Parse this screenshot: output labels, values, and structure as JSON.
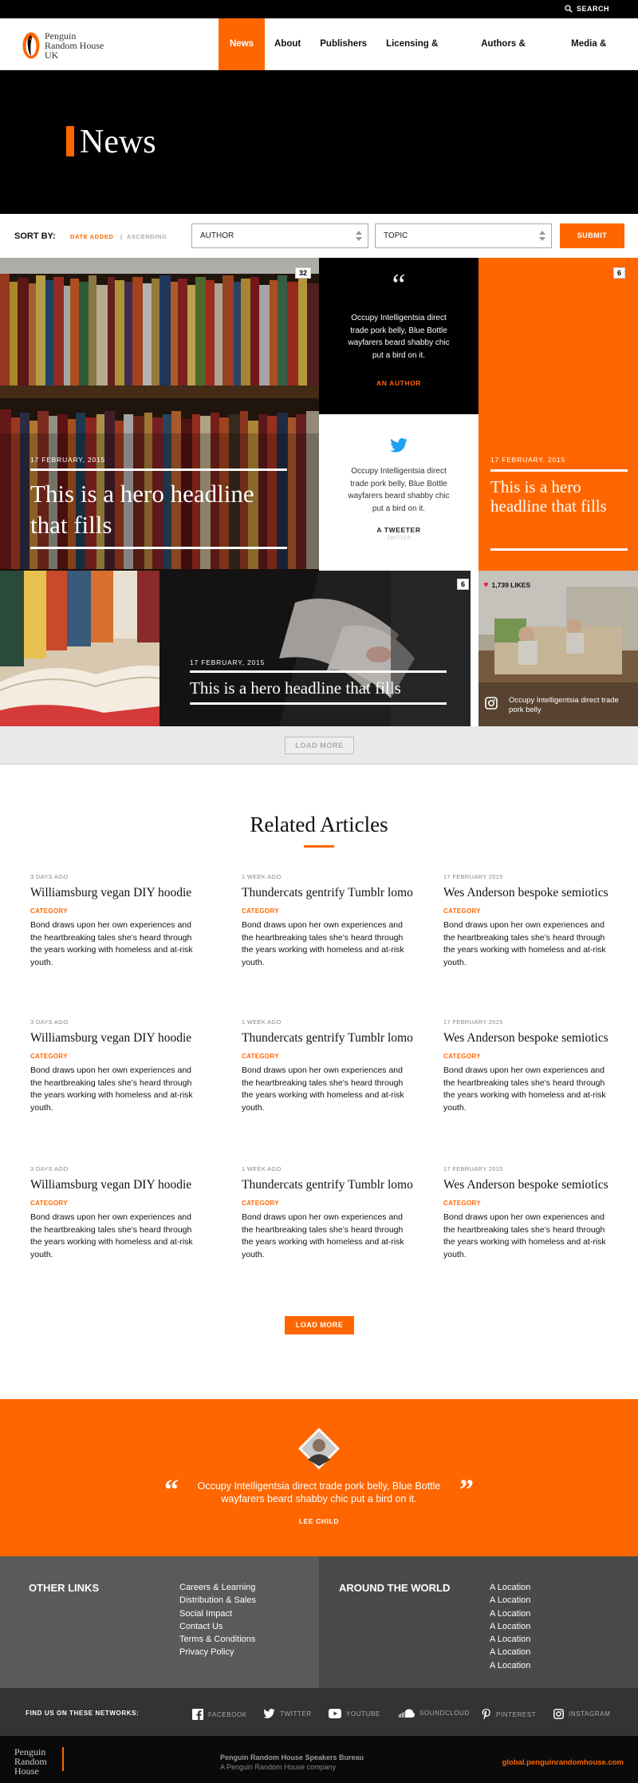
{
  "topbar": {
    "search_label": "SEARCH"
  },
  "logo": {
    "line1": "Penguin",
    "line2": "Random House",
    "line3": "UK"
  },
  "nav": {
    "items": [
      "News",
      "About",
      "Publishers",
      "Licensing & Rights",
      "Authors & Agents",
      "Media & Press"
    ]
  },
  "hero": {
    "title": "News"
  },
  "sort": {
    "label": "SORT BY:",
    "option1": "DATE ADDED",
    "separator": "|",
    "option2": "ASCENDING",
    "author_select": "AUTHOR",
    "topic_select": "TOPIC",
    "submit": "SUBMIT"
  },
  "grid": {
    "big": {
      "badge": "32",
      "date": "17 FEBRUARY, 2015",
      "headline": "This is a hero headline that fills"
    },
    "quote": {
      "mark": "“",
      "text": "Occupy Intelligentsia direct trade pork belly, Blue Bottle wayfarers beard shabby chic put a bird on it.",
      "author": "AN AUTHOR"
    },
    "tweet": {
      "text": "Occupy Intelligentsia direct trade pork belly, Blue Bottle wayfarers beard shabby chic put a bird on it.",
      "author": "A TWEETER",
      "sub": "TWITTER"
    },
    "orange": {
      "badge": "6",
      "date": "17 FEBRUARY, 2015",
      "headline": "This is a hero headline that fills"
    },
    "wide": {
      "badge": "6",
      "date": "17 FEBRUARY, 2015",
      "headline": "This is a hero headline that fills"
    },
    "insta": {
      "likes": "1,739 LIKES",
      "caption": "Occupy Intelligentsia direct trade pork belly"
    }
  },
  "load_more_top": "LOAD MORE",
  "related": {
    "title": "Related Articles",
    "articles": [
      {
        "age": "3 DAYS AGO",
        "title": "Williamsburg vegan DIY hoodie",
        "category": "CATEGORY",
        "body": "Bond draws upon her own experiences and the heartbreaking tales she’s heard through the years working with homeless and at-risk youth."
      },
      {
        "age": "1 WEEK AGO",
        "title": "Thundercats gentrify Tumblr lomo",
        "category": "CATEGORY",
        "body": "Bond draws upon her own experiences and the heartbreaking tales she’s heard through the years working with homeless and at-risk youth."
      },
      {
        "age": "17 FEBRUARY 2015",
        "title": "Wes Anderson bespoke semiotics",
        "category": "CATEGORY",
        "body": "Bond draws upon her own experiences and the heartbreaking tales she’s heard through the years working with homeless and at-risk youth."
      },
      {
        "age": "3 DAYS AGO",
        "title": "Williamsburg vegan DIY hoodie",
        "category": "CATEGORY",
        "body": "Bond draws upon her own experiences and the heartbreaking tales she’s heard through the years working with homeless and at-risk youth."
      },
      {
        "age": "1 WEEK AGO",
        "title": "Thundercats gentrify Tumblr lomo",
        "category": "CATEGORY",
        "body": "Bond draws upon her own experiences and the heartbreaking tales she’s heard through the years working with homeless and at-risk youth."
      },
      {
        "age": "17 FEBRUARY 2015",
        "title": "Wes Anderson bespoke semiotics",
        "category": "CATEGORY",
        "body": "Bond draws upon her own experiences and the heartbreaking tales she’s heard through the years working with homeless and at-risk youth."
      },
      {
        "age": "3 DAYS AGO",
        "title": "Williamsburg vegan DIY hoodie",
        "category": "CATEGORY",
        "body": "Bond draws upon her own experiences and the heartbreaking tales she’s heard through the years working with homeless and at-risk youth."
      },
      {
        "age": "1 WEEK AGO",
        "title": "Thundercats gentrify Tumblr lomo",
        "category": "CATEGORY",
        "body": "Bond draws upon her own experiences and the heartbreaking tales she’s heard through the years working with homeless and at-risk youth."
      },
      {
        "age": "17 FEBRUARY 2015",
        "title": "Wes Anderson bespoke semiotics",
        "category": "CATEGORY",
        "body": "Bond draws upon her own experiences and the heartbreaking tales she’s heard through the years working with homeless and at-risk youth."
      }
    ],
    "load_more": "LOAD MORE"
  },
  "quote_band": {
    "open": "“",
    "close": "”",
    "text": "Occupy Intelligentsia direct trade pork belly, Blue Bottle wayfarers beard shabby chic put a bird on it.",
    "author": "LEE CHILD"
  },
  "other_links": {
    "heading": "OTHER LINKS",
    "items": [
      "Careers & Learning",
      "Distribution & Sales",
      "Social Impact",
      "Contact Us",
      "Terms & Conditions",
      "Privacy Policy"
    ]
  },
  "world": {
    "heading": "AROUND THE WORLD",
    "items": [
      "A Location",
      "A Location",
      "A Location",
      "A Location",
      "A Location",
      "A Location",
      "A Location"
    ]
  },
  "social": {
    "label": "FIND US ON THESE NETWORKS:",
    "networks": [
      "FACEBOOK",
      "TWITTER",
      "YOUTUBE",
      "SOUNDCLOUD",
      "PINTEREST",
      "INSTAGRAM"
    ]
  },
  "footer": {
    "logo1": "Penguin",
    "logo2": "Random",
    "logo3": "House",
    "bureau": "Penguin Random House Speakers Bureau",
    "company": "A Penguin Random House company",
    "link": "global.penguinrandomhouse.com"
  },
  "colors": {
    "accent": "#ff6600",
    "black": "#000000",
    "dark_grey": "#4a4a4a",
    "mid_grey": "#5a5a5a"
  }
}
